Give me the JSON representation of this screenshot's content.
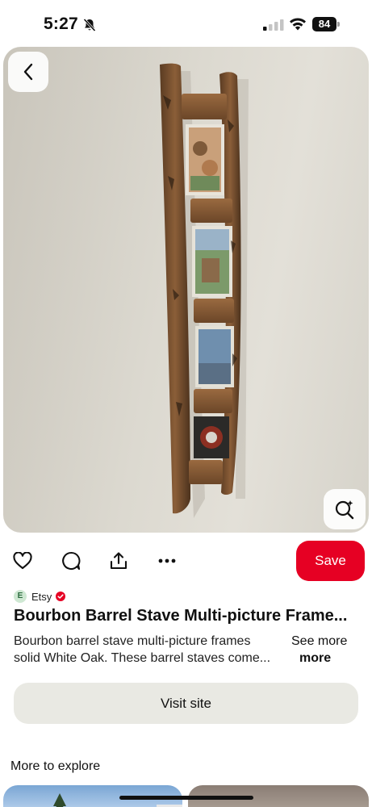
{
  "status_bar": {
    "time": "5:27",
    "battery": "84",
    "icons": [
      "bell-off-icon",
      "signal-icon",
      "wifi-icon",
      "battery-icon"
    ]
  },
  "pin": {
    "image_description_icon": "barrel-stave-frame-image",
    "back_icon": "chevron-left-icon",
    "visual_search_icon": "lens-search-icon"
  },
  "actions": {
    "icons": [
      "heart-icon",
      "comment-icon",
      "share-icon",
      "more-icon"
    ],
    "save_label": "Save"
  },
  "source": {
    "avatar_letter": "E",
    "name": "Etsy"
  },
  "title": "Bourbon Barrel Stave Multi-picture Frame...",
  "description": {
    "line1": "Bourbon barrel stave multi-picture frames",
    "line2": "solid White Oak. These barrel staves come...",
    "see_more_label": "See more",
    "more_label": "more"
  },
  "visit_site_label": "Visit site",
  "explore": {
    "heading": "More to explore"
  },
  "colors": {
    "save_red": "#e60023",
    "visit_bg": "#e9e9e3",
    "verified_red": "#e60023"
  }
}
